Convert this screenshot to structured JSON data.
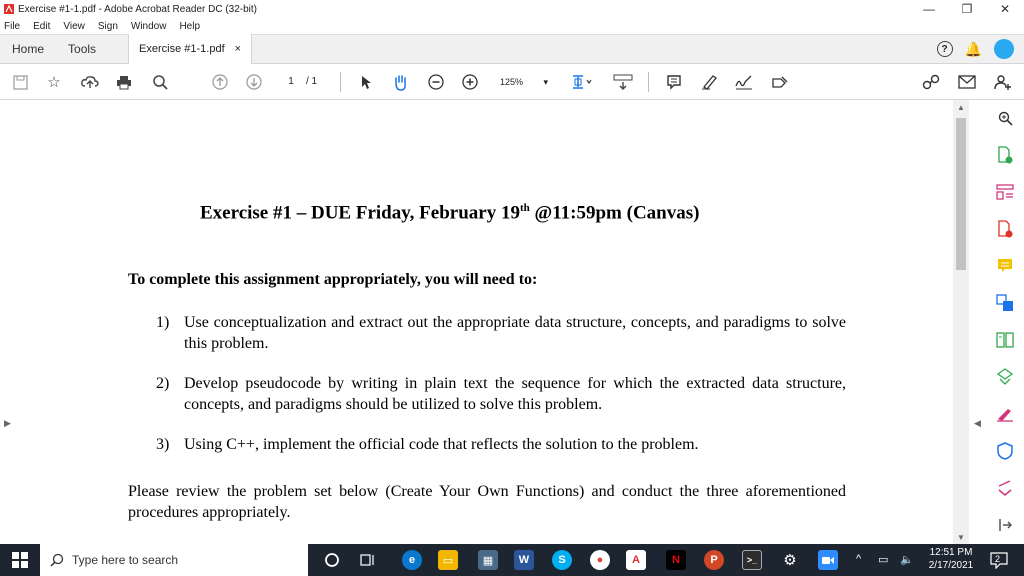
{
  "window": {
    "title": "Exercise #1-1.pdf - Adobe Acrobat Reader DC (32-bit)",
    "minimize": "—",
    "maximize": "❐",
    "close": "✕"
  },
  "menu": [
    "File",
    "Edit",
    "View",
    "Sign",
    "Window",
    "Help"
  ],
  "tabs": {
    "home": "Home",
    "tools": "Tools",
    "document": "Exercise #1-1.pdf",
    "close": "×",
    "help": "?"
  },
  "toolbar": {
    "page_current": "1",
    "page_total": "/ 1",
    "zoom": "125%"
  },
  "document": {
    "title": "Exercise #1 – DUE Friday, February 19",
    "title_sup": "th",
    "title_tail": " @11:59pm (Canvas)",
    "intro": "To complete this assignment appropriately, you will need to:",
    "items": [
      {
        "num": "1)",
        "text": "Use conceptualization and extract out the appropriate data structure, concepts, and paradigms to solve this problem."
      },
      {
        "num": "2)",
        "text": "Develop pseudocode by writing in plain text the sequence for which the extracted data structure, concepts, and paradigms should be utilized to solve this problem."
      },
      {
        "num": "3)",
        "text": "Using C++, implement the official code that reflects the solution to the problem."
      }
    ],
    "paragraph": "Please review the problem set below (Create Your Own Functions) and conduct the three aforementioned procedures appropriately."
  },
  "taskbar": {
    "search_placeholder": "Type here to search",
    "time": "12:51 PM",
    "date": "2/17/2021",
    "notifications": "2"
  },
  "colors": {
    "taskbar": "#1c2530",
    "profile": "#2aa8f0",
    "acrobat_red": "#e0312a",
    "tool_green": "#2fa84f",
    "tool_blue": "#1a73e8",
    "tool_pink": "#d3357c",
    "tool_yellow": "#f2c200"
  }
}
